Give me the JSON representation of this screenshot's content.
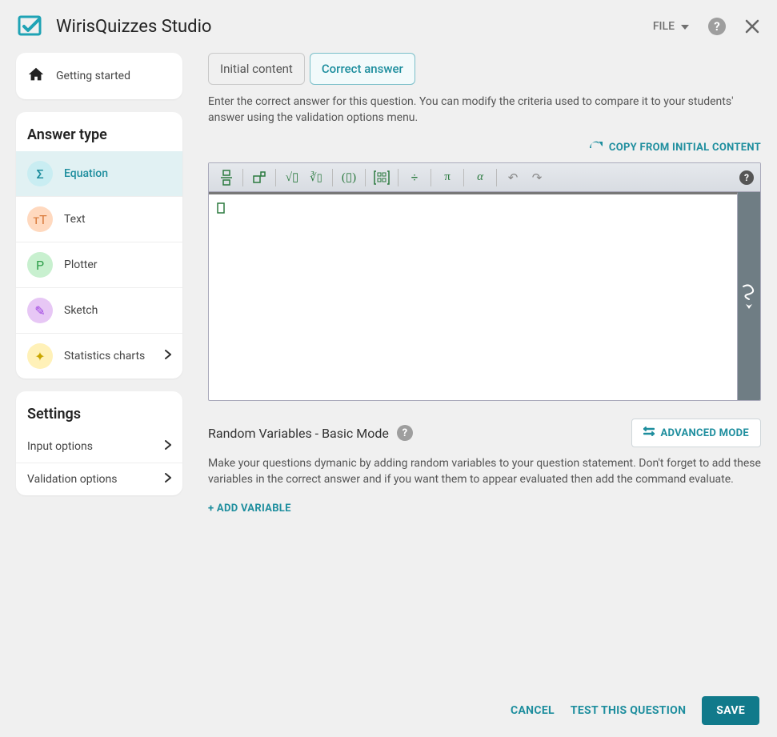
{
  "app_title": "WirisQuizzes Studio",
  "topbar": {
    "file_label": "FILE"
  },
  "sidebar": {
    "getting_started": "Getting started",
    "answer_type_header": "Answer type",
    "types": [
      {
        "label": "Equation",
        "icon": "Σ",
        "bg": "#c9edf2",
        "fg": "#1e8e9e",
        "active": true,
        "chevron": false
      },
      {
        "label": "Text",
        "icon": "тT",
        "bg": "#ffd9bf",
        "fg": "#d97a3a",
        "active": false,
        "chevron": false
      },
      {
        "label": "Plotter",
        "icon": "P",
        "bg": "#c8f0cf",
        "fg": "#2e9e4a",
        "active": false,
        "chevron": false
      },
      {
        "label": "Sketch",
        "icon": "✎",
        "bg": "#e7c7f5",
        "fg": "#9b3fe0",
        "active": false,
        "chevron": false
      },
      {
        "label": "Statistics charts",
        "icon": "✦",
        "bg": "#fff1b8",
        "fg": "#c9a600",
        "active": false,
        "chevron": true
      }
    ],
    "settings_header": "Settings",
    "settings": [
      {
        "label": "Input options"
      },
      {
        "label": "Validation options"
      }
    ]
  },
  "main": {
    "tabs": [
      {
        "label": "Initial content",
        "active": false
      },
      {
        "label": "Correct answer",
        "active": true
      }
    ],
    "description": "Enter the correct answer for this question. You can modify the criteria used to compare it to your students' answer using the validation options menu.",
    "copy_label": "COPY FROM INITIAL CONTENT",
    "random_title": "Random Variables - Basic Mode",
    "advanced_label": "ADVANCED MODE",
    "random_desc": "Make your questions dymanic by adding random variables to your question statement. Don't forget to add these variables in the correct answer and if you want them to appear evaluated then add the command evaluate.",
    "add_variable": "+ ADD VARIABLE"
  },
  "footer": {
    "cancel": "CANCEL",
    "test": "TEST THIS QUESTION",
    "save": "SAVE"
  }
}
